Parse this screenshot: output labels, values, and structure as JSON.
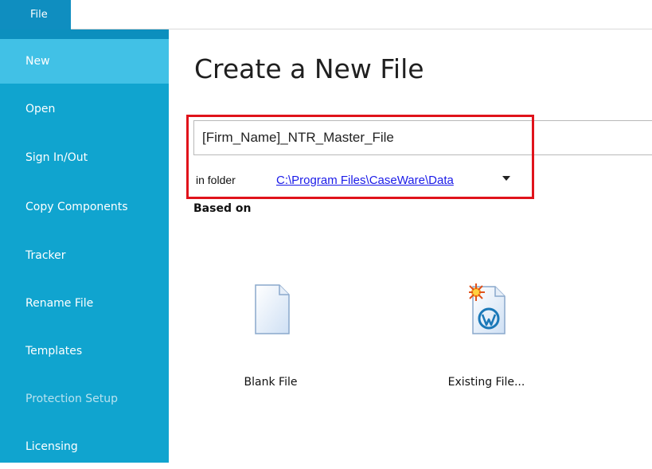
{
  "file_tab": {
    "label": "File"
  },
  "sidebar": {
    "items": [
      {
        "label": "New",
        "state": "active"
      },
      {
        "label": "Open",
        "state": "normal"
      },
      {
        "label": "Sign In/Out",
        "state": "normal"
      },
      {
        "label": "Copy Components",
        "state": "normal"
      },
      {
        "label": "Tracker",
        "state": "normal"
      },
      {
        "label": "Rename File",
        "state": "normal"
      },
      {
        "label": "Templates",
        "state": "normal"
      },
      {
        "label": "Protection Setup",
        "state": "disabled"
      },
      {
        "label": "Licensing",
        "state": "normal"
      }
    ]
  },
  "main": {
    "title": "Create a New File",
    "file_name": {
      "value": "[Firm_Name]_NTR_Master_File"
    },
    "folder": {
      "label": "in folder",
      "path": "C:\\Program Files\\CaseWare\\Data"
    },
    "based_on_label": "Based on",
    "tiles": [
      {
        "label": "Blank File",
        "icon": "blank-document-icon"
      },
      {
        "label": "Existing File...",
        "icon": "caseware-file-icon"
      }
    ]
  },
  "colors": {
    "sidebar_bg": "#10a4cf",
    "sidebar_active": "#41c1e6",
    "file_tab": "#0f8ec0",
    "highlight_box": "#e0131b",
    "link": "#1a1ae8"
  }
}
